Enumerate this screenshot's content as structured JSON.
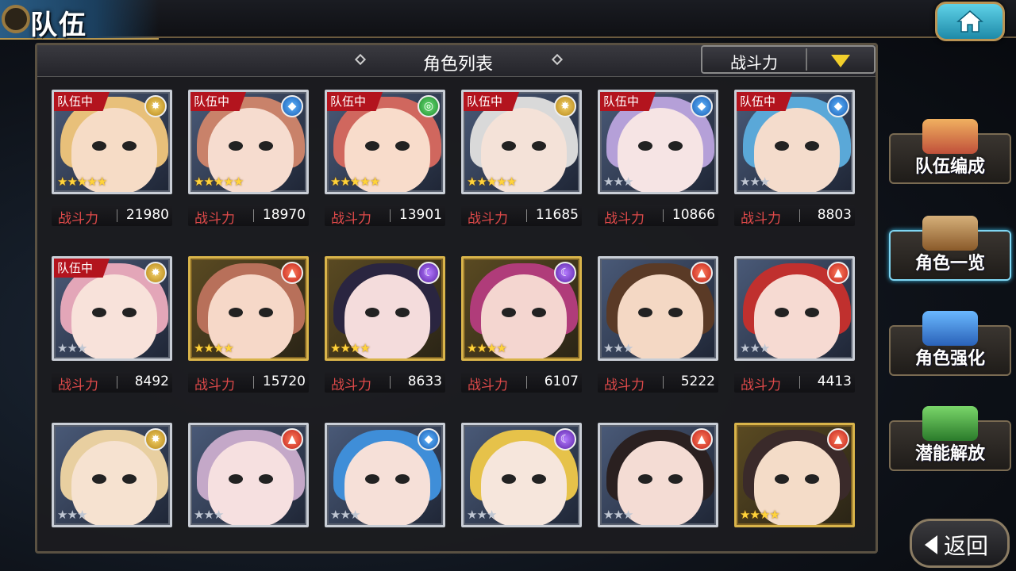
{
  "header": {
    "title": "队伍"
  },
  "panel": {
    "title": "角色列表",
    "sort_label": "战斗力"
  },
  "labels": {
    "in_team": "队伍中",
    "power": "战斗力"
  },
  "characters": [
    {
      "in_team": true,
      "element": "light",
      "stars": 5,
      "max_stars": 5,
      "power": "21980",
      "frame": "silver",
      "hair": "#e8c07a",
      "skin": "#f6dcc6"
    },
    {
      "in_team": true,
      "element": "water",
      "stars": 5,
      "max_stars": 5,
      "power": "18970",
      "frame": "silver",
      "hair": "#c9826a",
      "skin": "#f6dccf"
    },
    {
      "in_team": true,
      "element": "wind",
      "stars": 5,
      "max_stars": 5,
      "power": "13901",
      "frame": "silver",
      "hair": "#d0675e",
      "skin": "#f8dccb"
    },
    {
      "in_team": true,
      "element": "light",
      "stars": 5,
      "max_stars": 5,
      "power": "11685",
      "frame": "silver",
      "hair": "#d9d9d9",
      "skin": "#f4e2d8"
    },
    {
      "in_team": true,
      "element": "water",
      "stars": 3,
      "max_stars": 3,
      "power": "10866",
      "frame": "silver",
      "hair": "#b5a0d8",
      "skin": "#f6e4e4"
    },
    {
      "in_team": true,
      "element": "water",
      "stars": 3,
      "max_stars": 3,
      "power": "8803",
      "frame": "silver",
      "hair": "#5aa8d8",
      "skin": "#f4dccc"
    },
    {
      "in_team": true,
      "element": "light",
      "stars": 3,
      "max_stars": 3,
      "power": "8492",
      "frame": "silver",
      "hair": "#e3a6b8",
      "skin": "#f8e2da"
    },
    {
      "in_team": false,
      "element": "fire",
      "stars": 4,
      "max_stars": 4,
      "power": "15720",
      "frame": "gold",
      "hair": "#b8705a",
      "skin": "#f6d8c8"
    },
    {
      "in_team": false,
      "element": "dark",
      "stars": 4,
      "max_stars": 4,
      "power": "8633",
      "frame": "gold",
      "hair": "#2a2540",
      "skin": "#f4dcdc"
    },
    {
      "in_team": false,
      "element": "dark",
      "stars": 4,
      "max_stars": 4,
      "power": "6107",
      "frame": "gold",
      "hair": "#b03c7a",
      "skin": "#f4d6d0"
    },
    {
      "in_team": false,
      "element": "fire",
      "stars": 3,
      "max_stars": 3,
      "power": "5222",
      "frame": "silver",
      "hair": "#5a3a26",
      "skin": "#f4d8c4"
    },
    {
      "in_team": false,
      "element": "fire",
      "stars": 3,
      "max_stars": 3,
      "power": "4413",
      "frame": "silver",
      "hair": "#c0302e",
      "skin": "#f6dad2"
    },
    {
      "in_team": false,
      "element": "light",
      "stars": 3,
      "max_stars": 3,
      "power": "",
      "frame": "silver",
      "hair": "#e8cfa0",
      "skin": "#f6e2d0"
    },
    {
      "in_team": false,
      "element": "fire",
      "stars": 3,
      "max_stars": 3,
      "power": "",
      "frame": "silver",
      "hair": "#c4a8c8",
      "skin": "#f6e0e0"
    },
    {
      "in_team": false,
      "element": "water",
      "stars": 3,
      "max_stars": 3,
      "power": "",
      "frame": "silver",
      "hair": "#3f8ed8",
      "skin": "#f6e0d8"
    },
    {
      "in_team": false,
      "element": "dark",
      "stars": 3,
      "max_stars": 3,
      "power": "",
      "frame": "silver",
      "hair": "#e6c24a",
      "skin": "#f6e6dc"
    },
    {
      "in_team": false,
      "element": "fire",
      "stars": 3,
      "max_stars": 3,
      "power": "",
      "frame": "silver",
      "hair": "#2a2020",
      "skin": "#f4dcd4"
    },
    {
      "in_team": false,
      "element": "fire",
      "stars": 4,
      "max_stars": 4,
      "power": "",
      "frame": "gold",
      "hair": "#3a2a2a",
      "skin": "#f4dcc8"
    }
  ],
  "side_menu": [
    {
      "label": "队伍编成",
      "icon": "team-formation-icon",
      "active": false
    },
    {
      "label": "角色一览",
      "icon": "book-icon",
      "active": true
    },
    {
      "label": "角色强化",
      "icon": "enhance-icon",
      "active": false
    },
    {
      "label": "潜能解放",
      "icon": "potential-orb-icon",
      "active": false
    }
  ],
  "back_label": "返回",
  "colors": {
    "in_team_badge": "#b3141e",
    "power_label": "#e04a4a",
    "sort_arrow": "#f2cf2b",
    "accent": "#5fd2e8"
  }
}
